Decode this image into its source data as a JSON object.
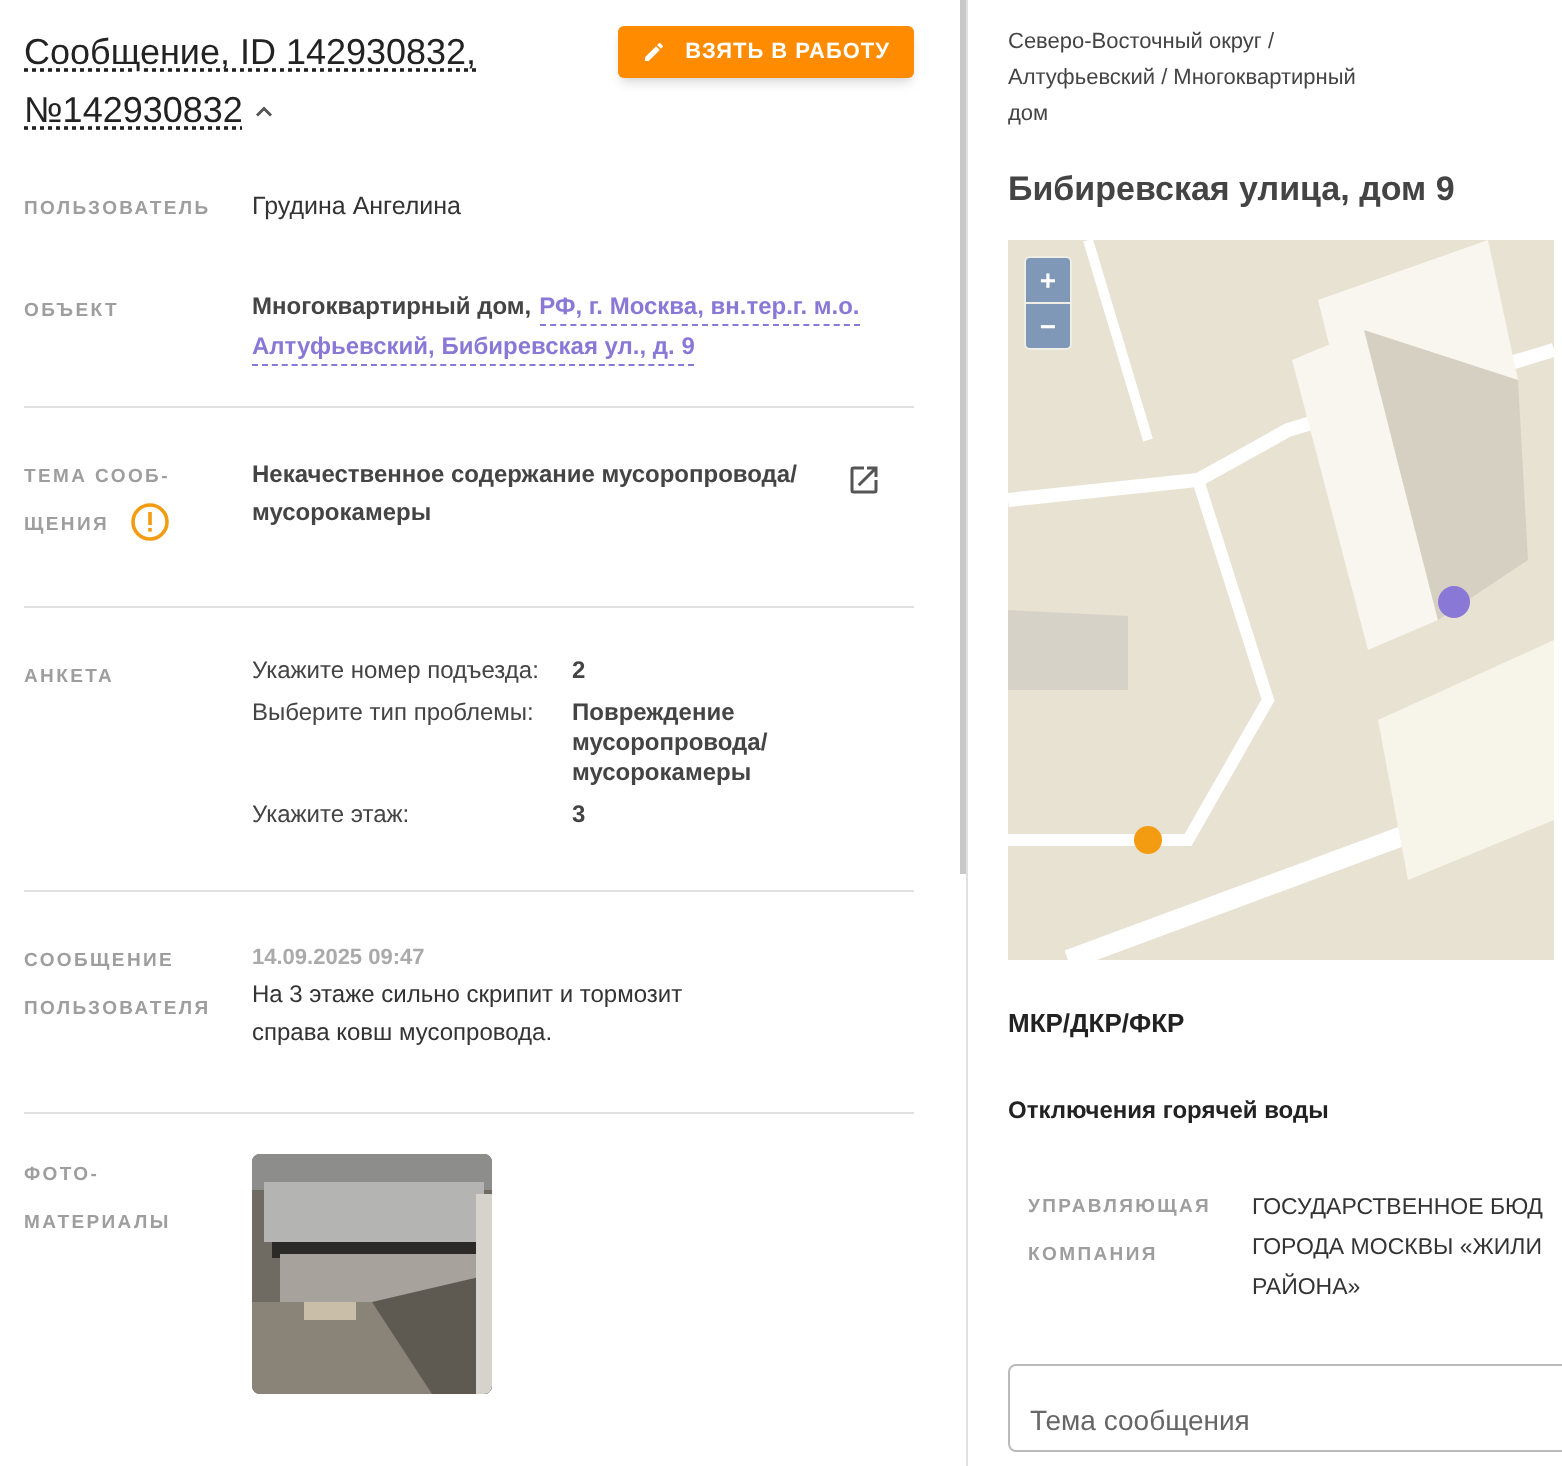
{
  "header": {
    "title_lines": [
      "Сообщение, ID 142930832,",
      "№142930832"
    ],
    "expanded": true,
    "action_button": "ВЗЯТЬ В РАБОТУ"
  },
  "fields": [
    {
      "kind": "text",
      "label": "ПОЛЬЗОВАТЕЛЬ",
      "value": "Грудина Ангелина"
    },
    {
      "kind": "object",
      "label": "ОБЪЕКТ",
      "value": "Многоквартирный дом,",
      "link_lines": [
        "РФ, г. Москва, вн.тер.г. м.о.",
        "Алтуфьевский, Бибиревская ул., д. 9"
      ]
    },
    {
      "kind": "topic",
      "label": "ТЕМА СООБ-\nЩЕНИЯ",
      "value": "Некачественное содержание мусоропровода/ мусорокамеры",
      "warning": true
    },
    {
      "kind": "survey",
      "label": "АНКЕТА",
      "answers": [
        {
          "question": "Укажите номер подъезда:",
          "answer": "2"
        },
        {
          "question": "Выберите тип проблемы:",
          "answer": "Повреждение мусоропровода/ мусорокамеры"
        },
        {
          "question": "Укажите этаж:",
          "answer": "3"
        }
      ]
    },
    {
      "kind": "message",
      "label": "СООБЩЕНИЕ\nПОЛЬЗОВАТЕЛЯ",
      "time": "14.09.2025 09:47",
      "value": "На 3 этаже сильно скрипит и тормозит справа ковш мусопровода."
    },
    {
      "kind": "photos",
      "label": "ФОТО-\nМАТЕРИАЛЫ"
    }
  ],
  "location": {
    "breadcrumb": "Северо-Восточный округ / Алтуфьевский / Многоквартирный дом",
    "address": "Бибиревская улица, дом 9",
    "map": {
      "zoom_in": "+",
      "zoom_out": "−"
    }
  },
  "sections": [
    {
      "kind": "heading",
      "text": "МКР/ДКР/ФКР"
    },
    {
      "kind": "subheading",
      "text": "Отключения горячей воды"
    }
  ],
  "management": {
    "label": "УПРАВЛЯЮЩАЯ\nКОМПАНИЯ",
    "value_lines": [
      "ГОСУДАРСТВЕННОЕ БЮД",
      "ГОРОДА МОСКВЫ «ЖИЛИ",
      "РАЙОНА»"
    ]
  },
  "topic_field": {
    "placeholder": "Тема сообщения"
  }
}
